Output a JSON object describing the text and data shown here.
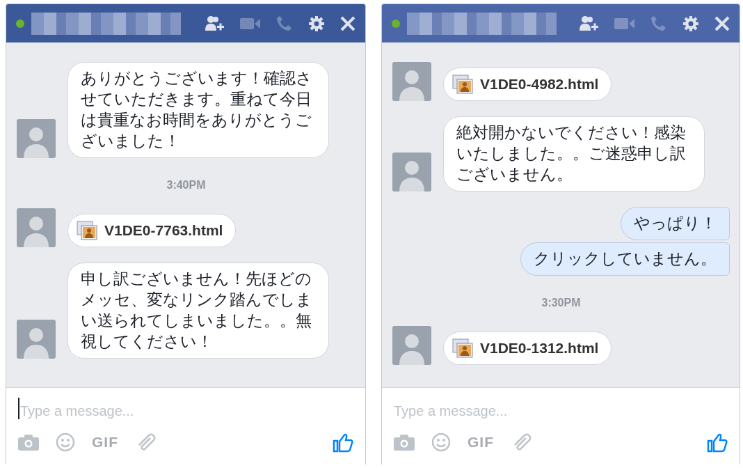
{
  "chats": [
    {
      "focused": true,
      "online": true,
      "messages": [
        {
          "kind": "text",
          "outgoing": false,
          "text": "ありがとうございます！確認させていただきます。重ねて今日は貴重なお時間をありがとうございました！"
        },
        {
          "kind": "time",
          "text": "3:40PM"
        },
        {
          "kind": "file",
          "outgoing": false,
          "text": "V1DE0-7763.html"
        },
        {
          "kind": "text",
          "outgoing": false,
          "text": "申し訳ございません！先ほどのメッセ、変なリンク踏んでしまい送られてしまいました。。無視してください！"
        }
      ],
      "composer": {
        "placeholder": "Type a message...",
        "gif": "GIF"
      }
    },
    {
      "focused": false,
      "online": true,
      "messages": [
        {
          "kind": "file",
          "outgoing": false,
          "text": "V1DE0-4982.html"
        },
        {
          "kind": "text",
          "outgoing": false,
          "text": "絶対開かないでください！感染いたしました。。ご迷惑申し訳ございません。"
        },
        {
          "kind": "text",
          "outgoing": true,
          "text": "やっぱり！"
        },
        {
          "kind": "text",
          "outgoing": true,
          "text": "クリックしていません。"
        },
        {
          "kind": "time",
          "text": "3:30PM"
        },
        {
          "kind": "file",
          "outgoing": false,
          "text": "V1DE0-1312.html"
        }
      ],
      "composer": {
        "placeholder": "Type a message...",
        "gif": "GIF"
      }
    }
  ]
}
